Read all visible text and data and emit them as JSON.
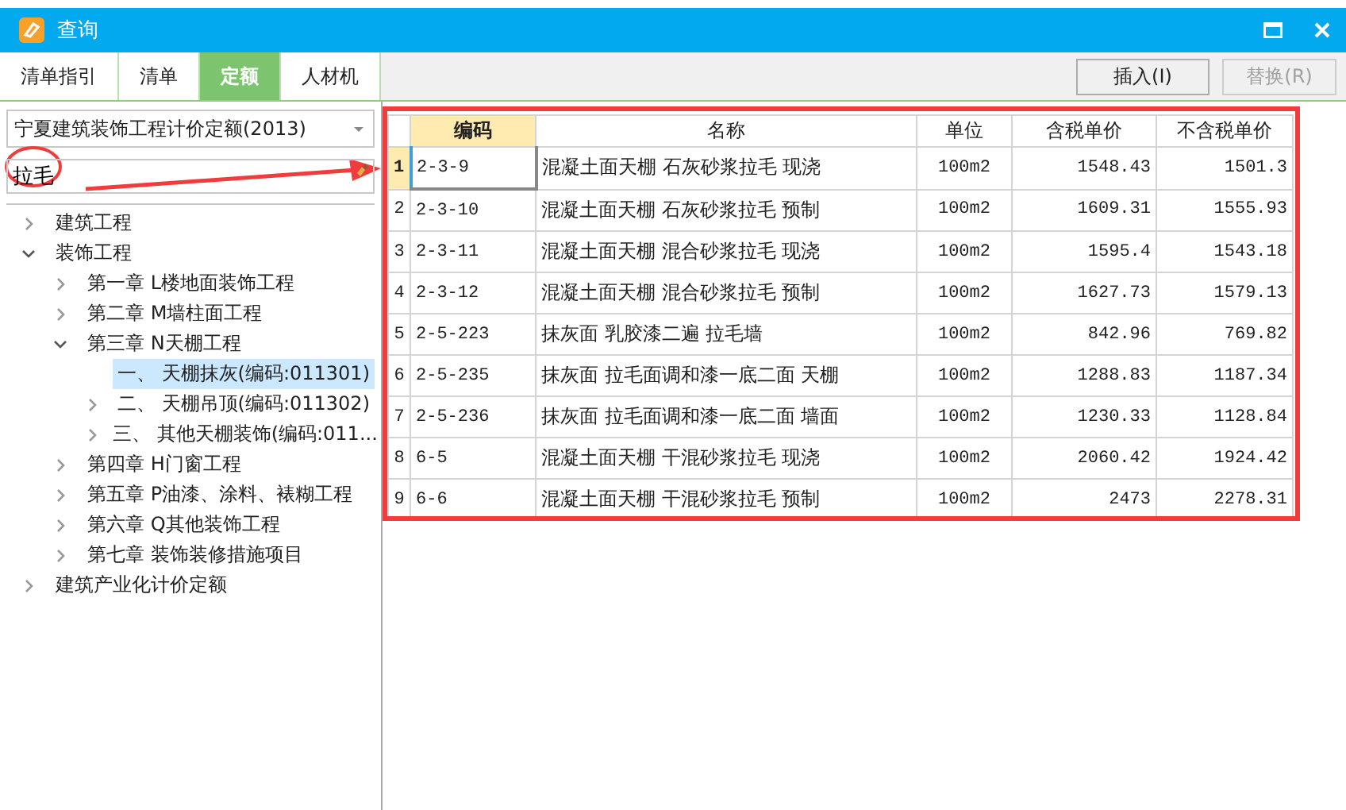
{
  "window": {
    "title": "查询"
  },
  "tabs": [
    {
      "label": "清单指引",
      "selected": false
    },
    {
      "label": "清单",
      "selected": false
    },
    {
      "label": "定额",
      "selected": true
    },
    {
      "label": "人材机",
      "selected": false
    }
  ],
  "buttons": [
    {
      "label": "插入(I)",
      "disabled": false
    },
    {
      "label": "替换(R)",
      "disabled": true
    }
  ],
  "library_dropdown": {
    "value": "宁夏建筑装饰工程计价定额(2013)"
  },
  "search": {
    "value": "拉毛"
  },
  "tree": [
    {
      "label": "建筑工程",
      "expanded": false,
      "selected": false
    },
    {
      "label": "装饰工程",
      "expanded": true,
      "selected": false,
      "children": [
        {
          "label": "第一章 L楼地面装饰工程",
          "expanded": false,
          "selected": false
        },
        {
          "label": "第二章 M墙柱面工程",
          "expanded": false,
          "selected": false
        },
        {
          "label": "第三章 N天棚工程",
          "expanded": true,
          "selected": false,
          "children": [
            {
              "label": "一、 天棚抹灰(编码:011301)",
              "selected": true
            },
            {
              "label": "二、 天棚吊顶(编码:011302)",
              "expanded": false,
              "selected": false
            },
            {
              "label": "三、 其他天棚装饰(编码:011...",
              "expanded": false,
              "selected": false
            }
          ]
        },
        {
          "label": "第四章 H门窗工程",
          "expanded": false,
          "selected": false
        },
        {
          "label": "第五章 P油漆、涂料、裱糊工程",
          "expanded": false,
          "selected": false
        },
        {
          "label": "第六章 Q其他装饰工程",
          "expanded": false,
          "selected": false
        },
        {
          "label": "第七章 装饰装修措施项目",
          "expanded": false,
          "selected": false
        }
      ]
    },
    {
      "label": "建筑产业化计价定额",
      "expanded": false,
      "selected": false
    }
  ],
  "table": {
    "columns": [
      {
        "label": "编码",
        "selected": true
      },
      {
        "label": "名称",
        "selected": false
      },
      {
        "label": "单位",
        "selected": false
      },
      {
        "label": "含税单价",
        "selected": false
      },
      {
        "label": "不含税单价",
        "selected": false
      }
    ],
    "rows": [
      {
        "number": "1",
        "selected": true,
        "cells": [
          "2-3-9",
          "混凝土面天棚 石灰砂浆拉毛 现浇",
          "100m2",
          "1548.43",
          "1501.3"
        ]
      },
      {
        "number": "2",
        "selected": false,
        "cells": [
          "2-3-10",
          "混凝土面天棚 石灰砂浆拉毛 预制",
          "100m2",
          "1609.31",
          "1555.93"
        ]
      },
      {
        "number": "3",
        "selected": false,
        "cells": [
          "2-3-11",
          "混凝土面天棚 混合砂浆拉毛 现浇",
          "100m2",
          "1595.4",
          "1543.18"
        ]
      },
      {
        "number": "4",
        "selected": false,
        "cells": [
          "2-3-12",
          "混凝土面天棚 混合砂浆拉毛 预制",
          "100m2",
          "1627.73",
          "1579.13"
        ]
      },
      {
        "number": "5",
        "selected": false,
        "cells": [
          "2-5-223",
          "抹灰面 乳胶漆二遍 拉毛墙",
          "100m2",
          "842.96",
          "769.82"
        ]
      },
      {
        "number": "6",
        "selected": false,
        "cells": [
          "2-5-235",
          "抹灰面 拉毛面调和漆一底二面 天棚",
          "100m2",
          "1288.83",
          "1187.34"
        ]
      },
      {
        "number": "7",
        "selected": false,
        "cells": [
          "2-5-236",
          "抹灰面 拉毛面调和漆一底二面 墙面",
          "100m2",
          "1230.33",
          "1128.84"
        ]
      },
      {
        "number": "8",
        "selected": false,
        "cells": [
          "6-5",
          "混凝土面天棚 干混砂浆拉毛 现浇",
          "100m2",
          "2060.42",
          "1924.42"
        ]
      },
      {
        "number": "9",
        "selected": false,
        "cells": [
          "6-6",
          "混凝土面天棚 干混砂浆拉毛 预制",
          "100m2",
          "2473",
          "2278.31"
        ]
      }
    ]
  }
}
